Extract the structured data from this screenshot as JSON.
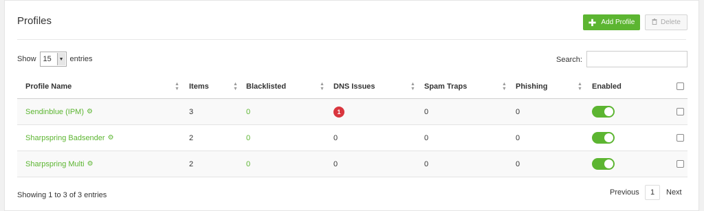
{
  "header": {
    "title": "Profiles",
    "add_label": "Add Profile",
    "add_icon": "plus-icon",
    "delete_label": "Delete",
    "delete_icon": "trash-icon"
  },
  "controls": {
    "show_label": "Show",
    "entries_value": "15",
    "entries_label": "entries",
    "search_label": "Search:",
    "search_value": ""
  },
  "table": {
    "columns": [
      "Profile Name",
      "Items",
      "Blacklisted",
      "DNS Issues",
      "Spam Traps",
      "Phishing",
      "Enabled"
    ],
    "rows": [
      {
        "name": "Sendinblue (IPM)",
        "items": "3",
        "blacklisted": "0",
        "dns": "1",
        "spam": "0",
        "phishing": "0",
        "enabled": true
      },
      {
        "name": "Sharpspring Badsender",
        "items": "2",
        "blacklisted": "0",
        "dns": "0",
        "spam": "0",
        "phishing": "0",
        "enabled": true
      },
      {
        "name": "Sharpspring Multi",
        "items": "2",
        "blacklisted": "0",
        "dns": "0",
        "spam": "0",
        "phishing": "0",
        "enabled": true
      }
    ]
  },
  "footer": {
    "info": "Showing 1 to 3 of 3 entries",
    "previous": "Previous",
    "page": "1",
    "next": "Next"
  },
  "colors": {
    "accent": "#5cb531",
    "danger_badge": "#d9363e"
  }
}
